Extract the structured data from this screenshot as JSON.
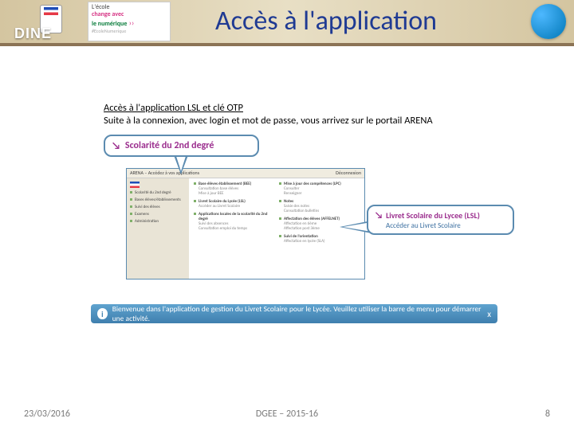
{
  "header": {
    "dine": "DINE",
    "ecole": {
      "l1": "L'école",
      "l2": "change avec",
      "l3": "le numérique",
      "arrows": " ››",
      "sub": "#EcoleNumerique"
    },
    "title": "Accès à l'application"
  },
  "body": {
    "section_title": "Accès à l'application LSL et clé OTP",
    "section_sub": "Suite à la connexion, avec login et mot de passe, vous arrivez sur le portail ARENA",
    "callout1": {
      "arrow": "↘",
      "text": "Scolarité du 2nd degré"
    },
    "callout2": {
      "arrow": "↘",
      "line1": "Livret Scolaire du Lycee (LSL)",
      "line2": "Accéder au Livret Scolaire"
    },
    "arena": {
      "top_left": "ARENA – Accédez à vos applications",
      "top_right": "Déconnexion",
      "side_items": [
        "Scolarité du 2nd degré",
        "Bases élèves/établissements",
        "Suivi des élèves",
        "Examens",
        "Administration"
      ],
      "col1": [
        {
          "hd": "Base élèves établissement (BEE)",
          "ln": [
            "Consultation base élèves",
            "Mise à jour BEE"
          ]
        },
        {
          "hd": "Livret Scolaire du Lycée (LSL)",
          "ln": [
            "Accéder au Livret Scolaire"
          ]
        },
        {
          "hd": "Applications locales de la scolarité du 2nd degré",
          "ln": [
            "Suivi des absences",
            "Consultation emploi du temps"
          ]
        }
      ],
      "col2": [
        {
          "hd": "Mise à jour des compétences (LPC)",
          "ln": [
            "Consulter",
            "Renseigner"
          ]
        },
        {
          "hd": "Notes",
          "ln": [
            "Saisie des notes",
            "Consultation bulletins"
          ]
        },
        {
          "hd": "Affectation des élèves (AFFELNET)",
          "ln": [
            "Affectation en 6ème",
            "Affectation post 3ème"
          ]
        },
        {
          "hd": "Suivi de l'orientation",
          "ln": [
            "Affectation en lycée (SLA)"
          ]
        }
      ]
    },
    "welcome": {
      "icon": "i",
      "text": "Bienvenue dans l'application de gestion du Livret Scolaire pour le Lycée. Veuillez utiliser la barre de menu pour démarrer une activité.",
      "close": "x"
    }
  },
  "footer": {
    "date": "23/03/2016",
    "center": "DGEE – 2015-16",
    "page": "8"
  }
}
